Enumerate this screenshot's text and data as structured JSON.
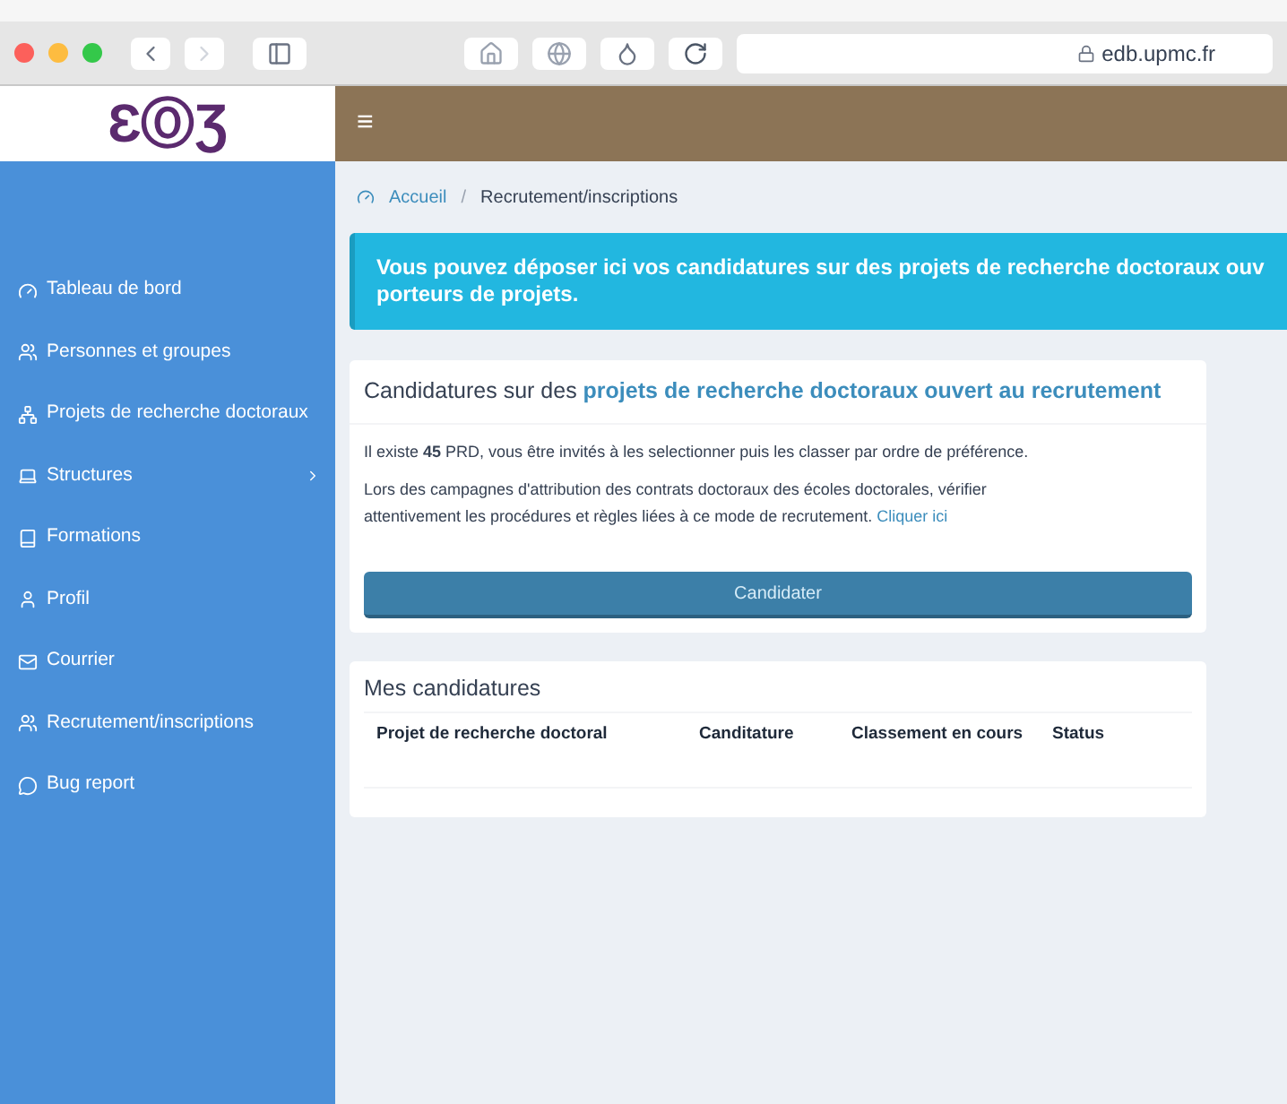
{
  "browser": {
    "url": "edb.upmc.fr"
  },
  "header": {
    "logo": "ƐⓄƷ",
    "menu_toggle": "≡"
  },
  "sidebar": {
    "items": [
      {
        "label": "Tableau de bord",
        "kind": "dashboard",
        "has_submenu": false
      },
      {
        "label": "Personnes et groupes",
        "kind": "users",
        "has_submenu": false
      },
      {
        "label": "Projets de recherche doctoraux",
        "kind": "network",
        "has_submenu": false
      },
      {
        "label": "Structures",
        "kind": "laptop",
        "has_submenu": true
      },
      {
        "label": "Formations",
        "kind": "book",
        "has_submenu": false
      },
      {
        "label": "Profil",
        "kind": "user",
        "has_submenu": false
      },
      {
        "label": "Courrier",
        "kind": "mail",
        "has_submenu": false
      },
      {
        "label": "Recrutement/inscriptions",
        "kind": "users",
        "has_submenu": false
      },
      {
        "label": "Bug report",
        "kind": "chat",
        "has_submenu": false
      }
    ]
  },
  "breadcrumb_separator": "/",
  "breadcrumb": [
    {
      "label": "Accueil"
    },
    {
      "label": "Recrutement/inscriptions"
    }
  ],
  "alert": {
    "lines": [
      "Vous pouvez déposer ici vos candidatures sur des projets de recherche doctoraux ouv",
      "porteurs de projets."
    ]
  },
  "card": {
    "title": "Candidatures sur des **projets de recherche doctoraux ouvert au recrutement**",
    "paragraph_1": "Il existe **45** PRD, vous être invités à les selectionner puis les classer par ordre de préférence.",
    "paragraph_2": "Lors des campagnes d'attribution des contrats doctoraux des écoles doctorales, vérifier attentivement les procédures et règles liées à ce mode de recrutement.",
    "link": "Cliquer ici",
    "button": "Candidater"
  },
  "applications": {
    "title": "Mes candidatures",
    "columns": [
      "Projet de recherche doctoral",
      "Canditature",
      "Classement en cours",
      "Status"
    ]
  }
}
